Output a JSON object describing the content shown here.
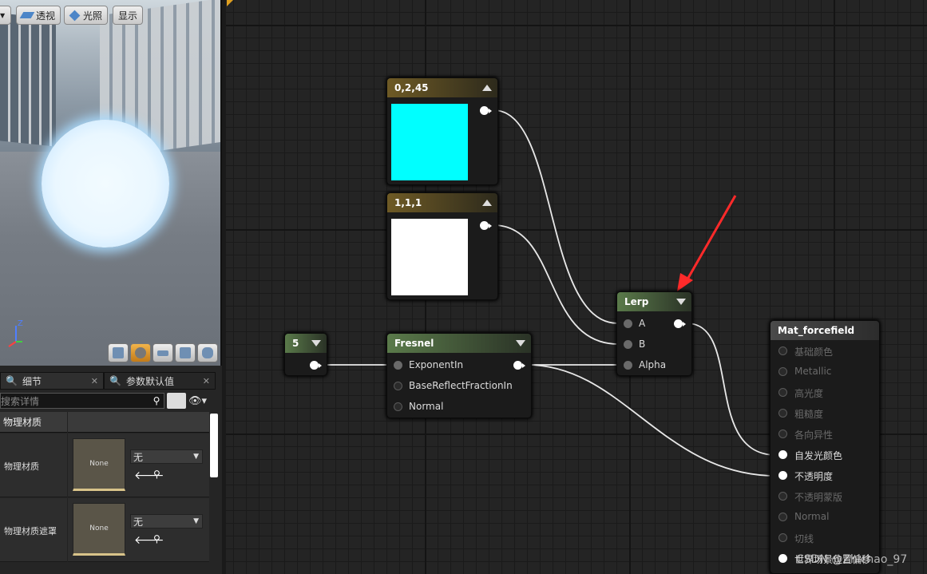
{
  "viewport": {
    "toolbar": {
      "perspective": "透视",
      "lit": "光照",
      "show": "显示"
    },
    "axis": {
      "z": "Z"
    }
  },
  "details": {
    "tabs": [
      {
        "label": "细节"
      },
      {
        "label": "参数默认值"
      }
    ],
    "search_placeholder": "搜索详情",
    "category": "物理材质",
    "rows": [
      {
        "label": "物理材质",
        "thumb": "None",
        "value": "无"
      },
      {
        "label": "物理材质遮罩",
        "thumb": "None",
        "value": "无"
      }
    ]
  },
  "graph": {
    "nodes": {
      "const_a": {
        "title": "0,2,45",
        "color": "#00ffff"
      },
      "const_b": {
        "title": "1,1,1",
        "color": "#ffffff"
      },
      "scalar": {
        "title": "5"
      },
      "fresnel": {
        "title": "Fresnel",
        "inputs": [
          "ExponentIn",
          "BaseReflectFractionIn",
          "Normal"
        ]
      },
      "lerp": {
        "title": "Lerp",
        "inputs": [
          "A",
          "B",
          "Alpha"
        ]
      },
      "result": {
        "title": "Mat_forcefield",
        "inputs": [
          {
            "label": "基础颜色",
            "active": false
          },
          {
            "label": "Metallic",
            "active": false
          },
          {
            "label": "高光度",
            "active": false
          },
          {
            "label": "粗糙度",
            "active": false
          },
          {
            "label": "各向异性",
            "active": false
          },
          {
            "label": "自发光颜色",
            "active": true
          },
          {
            "label": "不透明度",
            "active": true
          },
          {
            "label": "不透明蒙版",
            "active": false
          },
          {
            "label": "Normal",
            "active": false
          },
          {
            "label": "切线",
            "active": false
          },
          {
            "label": "世界场景位置偏移",
            "active": true
          }
        ]
      }
    },
    "annotation_color": "#ff2a2a"
  },
  "watermark": "CSDN @Zhichao_97"
}
